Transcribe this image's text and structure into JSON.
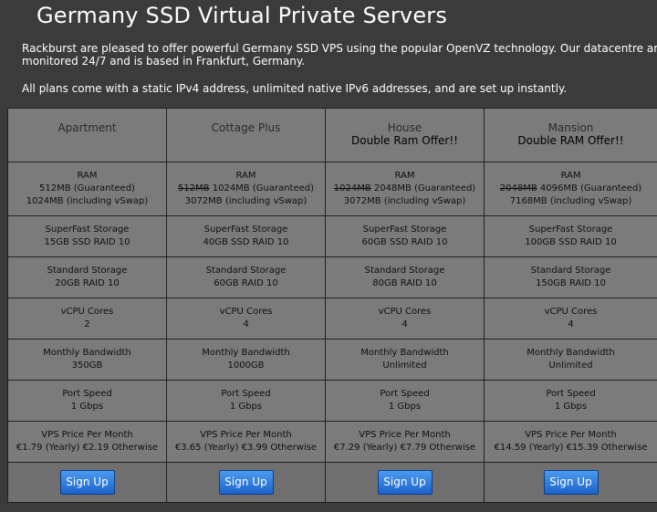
{
  "page": {
    "title": "Germany SSD Virtual Private Servers",
    "intro": "Rackburst are pleased to offer powerful Germany SSD VPS using the popular OpenVZ technology. Our datacentre and n",
    "intro_line2": "monitored 24/7 and is based in Frankfurt, Germany.",
    "intro2": "All plans come with a static IPv4 address, unlimited native IPv6 addresses, and are set up instantly."
  },
  "plans": [
    {
      "name": "Apartment",
      "offer": "",
      "ram_label": "RAM",
      "ram_old": "",
      "ram_value": "512MB (Guaranteed)",
      "ram_vswap": "1024MB (including vSwap)",
      "ssd_label": "SuperFast Storage",
      "ssd_value": "15GB SSD RAID 10",
      "std_label": "Standard Storage",
      "std_value": "20GB RAID 10",
      "cpu_label": "vCPU Cores",
      "cpu_value": "2",
      "bw_label": "Monthly Bandwidth",
      "bw_value": "350GB",
      "port_label": "Port Speed",
      "port_value": "1 Gbps",
      "price_label": "VPS Price Per Month",
      "price_value": "€1.79 (Yearly) €2.19 Otherwise",
      "signup": "Sign Up"
    },
    {
      "name": "Cottage Plus",
      "offer": "",
      "ram_label": "RAM",
      "ram_old": "512MB",
      "ram_value": "1024MB (Guaranteed)",
      "ram_vswap": "3072MB (including vSwap)",
      "ssd_label": "SuperFast Storage",
      "ssd_value": "40GB SSD RAID 10",
      "std_label": "Standard Storage",
      "std_value": "60GB RAID 10",
      "cpu_label": "vCPU Cores",
      "cpu_value": "4",
      "bw_label": "Monthly Bandwidth",
      "bw_value": "1000GB",
      "port_label": "Port Speed",
      "port_value": "1 Gbps",
      "price_label": "VPS Price Per Month",
      "price_value": "€3.65 (Yearly) €3.99 Otherwise",
      "signup": "Sign Up"
    },
    {
      "name": "House",
      "offer": "Double Ram Offer!!",
      "ram_label": "RAM",
      "ram_old": "1024MB",
      "ram_value": "2048MB (Guaranteed)",
      "ram_vswap": "3072MB (including vSwap)",
      "ssd_label": "SuperFast Storage",
      "ssd_value": "60GB SSD RAID 10",
      "std_label": "Standard Storage",
      "std_value": "80GB RAID 10",
      "cpu_label": "vCPU Cores",
      "cpu_value": "4",
      "bw_label": "Monthly Bandwidth",
      "bw_value": "Unlimited",
      "port_label": "Port Speed",
      "port_value": "1 Gbps",
      "price_label": "VPS Price Per Month",
      "price_value": "€7.29 (Yearly) €7.79 Otherwise",
      "signup": "Sign Up"
    },
    {
      "name": "Mansion",
      "offer": "Double RAM Offer!!",
      "ram_label": "RAM",
      "ram_old": "2048MB",
      "ram_value": "4096MB (Guaranteed)",
      "ram_vswap": "7168MB (including vSwap)",
      "ssd_label": "SuperFast Storage",
      "ssd_value": "100GB SSD RAID 10",
      "std_label": "Standard Storage",
      "std_value": "150GB RAID 10",
      "cpu_label": "vCPU Cores",
      "cpu_value": "4",
      "bw_label": "Monthly Bandwidth",
      "bw_value": "Unlimited",
      "port_label": "Port Speed",
      "port_value": "1 Gbps",
      "price_label": "VPS Price Per Month",
      "price_value": "€14.59 (Yearly) €15.39 Otherwise",
      "signup": "Sign Up"
    }
  ],
  "colors": {
    "background": "#3b3b3b",
    "cell": "#7b7b7b",
    "button": "#1f6fd6"
  }
}
